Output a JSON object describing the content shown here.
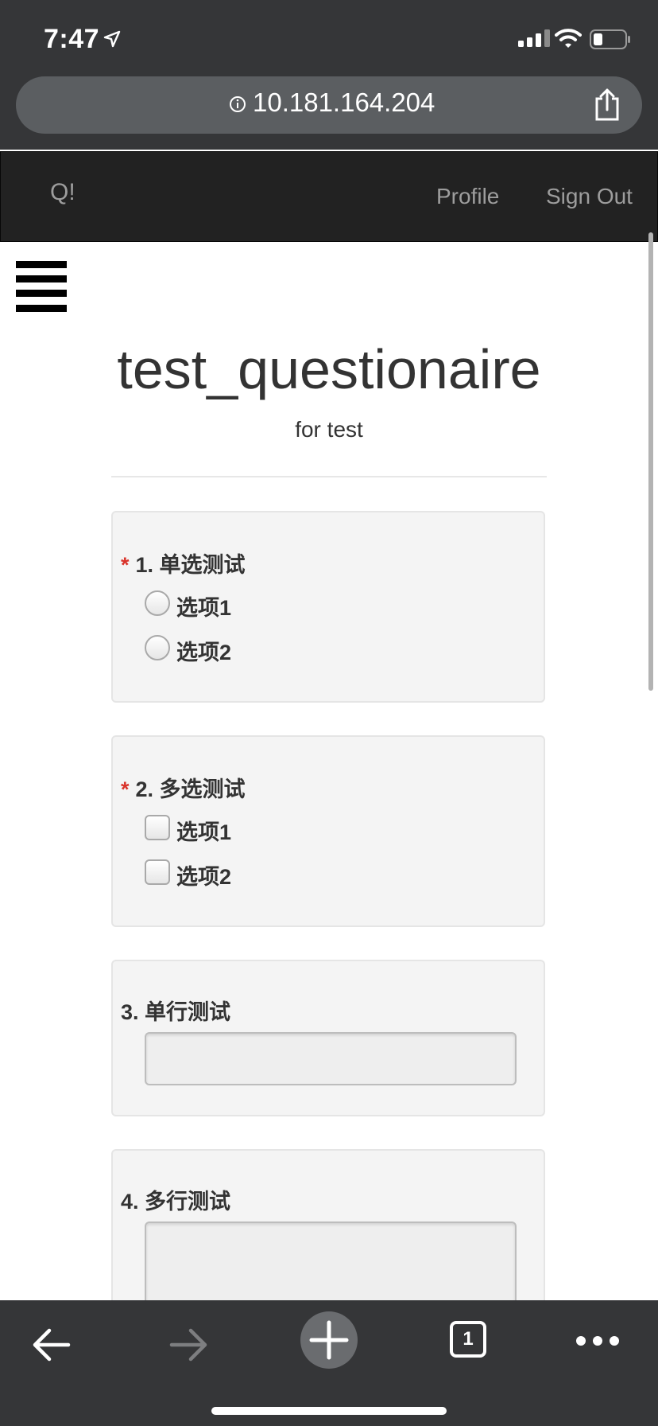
{
  "status_bar": {
    "time": "7:47"
  },
  "browser": {
    "url": "10.181.164.204",
    "tab_count": "1"
  },
  "navbar": {
    "brand": "Q!",
    "profile": "Profile",
    "sign_out": "Sign Out"
  },
  "page": {
    "title": "test_questionaire",
    "subtitle": "for test"
  },
  "questions": [
    {
      "required_mark": "*",
      "label": "1. 单选测试",
      "type": "radio",
      "options": [
        "选项1",
        "选项2"
      ]
    },
    {
      "required_mark": "*",
      "label": "2. 多选测试",
      "type": "checkbox",
      "options": [
        "选项1",
        "选项2"
      ]
    },
    {
      "label": "3. 单行测试",
      "type": "text",
      "value": ""
    },
    {
      "label": "4. 多行测试",
      "type": "textarea",
      "value": ""
    }
  ],
  "icons": {
    "location": "location-arrow-icon",
    "signal": "cellular-signal-icon",
    "wifi": "wifi-icon",
    "battery": "battery-icon",
    "info": "info-icon",
    "share": "share-icon",
    "menu": "hamburger-menu-icon",
    "back": "arrow-left-icon",
    "forward": "arrow-right-icon",
    "new_tab": "plus-icon",
    "more": "more-dots-icon"
  },
  "colors": {
    "chrome": "#353638",
    "navbar": "#222222",
    "required": "#d9332a",
    "card_bg": "#f4f4f4"
  }
}
